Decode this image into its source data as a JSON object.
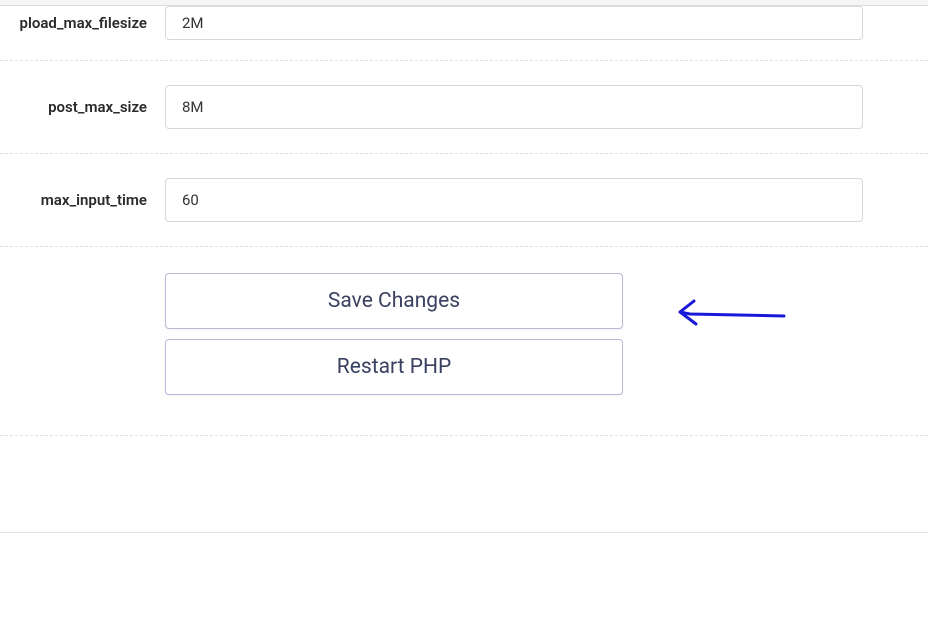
{
  "fields": [
    {
      "label": "pload_max_filesize",
      "value": "2M"
    },
    {
      "label": "post_max_size",
      "value": "8M"
    },
    {
      "label": "max_input_time",
      "value": "60"
    }
  ],
  "buttons": {
    "save": "Save Changes",
    "restart": "Restart PHP"
  }
}
